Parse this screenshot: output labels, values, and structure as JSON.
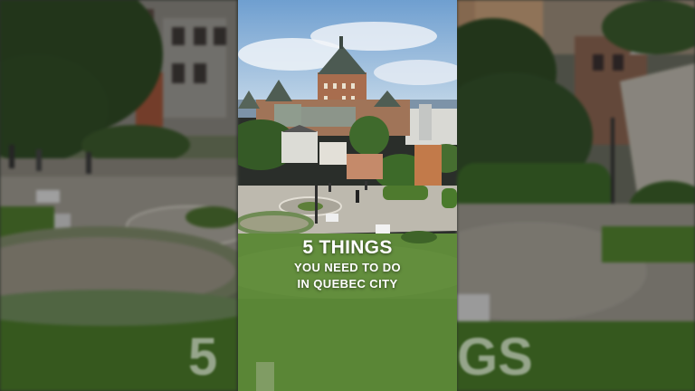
{
  "overlay": {
    "line1": "5 THINGS",
    "line2": "YOU NEED TO DO",
    "line3": "IN QUEBEC CITY"
  },
  "ghost_text": {
    "left": "5",
    "right": "GS"
  },
  "colors": {
    "sky": "#8fb6dc",
    "grass": "#5f8a3a",
    "path": "#b9b6ad",
    "castle_roof": "#4c5a52",
    "brick": "#a8704f"
  }
}
